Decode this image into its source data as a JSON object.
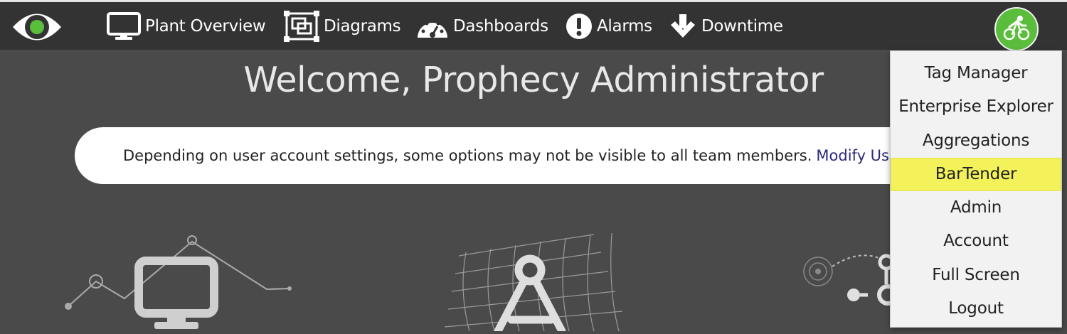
{
  "topbar": {
    "logo_icon": "eye-icon",
    "nav": [
      {
        "label": "Plant Overview",
        "icon": "monitor-icon"
      },
      {
        "label": "Diagrams",
        "icon": "diagram-icon"
      },
      {
        "label": "Dashboards",
        "icon": "speedometer-icon"
      },
      {
        "label": "Alarms",
        "icon": "exclamation-circle-icon"
      },
      {
        "label": "Downtime",
        "icon": "arrow-down-icon"
      }
    ],
    "avatar_icon": "cyclist-icon",
    "avatar_color": "#5bbd3c"
  },
  "main": {
    "welcome": "Welcome, Prophecy Administrator",
    "notice_text": "Depending on user account settings, some options may not be visible to all team members.",
    "notice_link": "Modify User"
  },
  "user_menu": {
    "items": [
      {
        "label": "Tag Manager"
      },
      {
        "label": "Enterprise Explorer"
      },
      {
        "label": "Aggregations"
      },
      {
        "label": "BarTender",
        "highlighted": true
      },
      {
        "label": "Admin"
      },
      {
        "label": "Account"
      },
      {
        "label": "Full Screen"
      },
      {
        "label": "Logout"
      }
    ],
    "highlight_color": "#f3f25a"
  },
  "colors": {
    "topbar": "#333333",
    "background": "#4a4a4a",
    "accent_green": "#5bbd3c"
  }
}
